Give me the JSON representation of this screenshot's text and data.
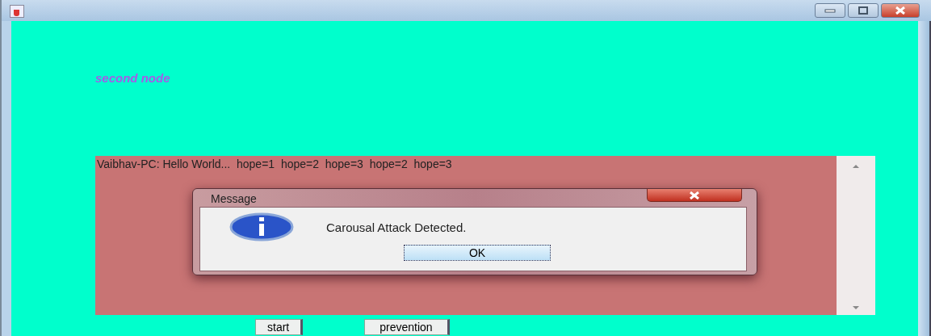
{
  "heading": "second node",
  "log": {
    "text": "Vaibhav-PC: Hello World...  hope=1  hope=2  hope=3  hope=2  hope=3"
  },
  "dialog": {
    "title": "Message",
    "message": "Carousal Attack Detected.",
    "button": "OK"
  },
  "buttons": [
    "start",
    "prevention"
  ]
}
